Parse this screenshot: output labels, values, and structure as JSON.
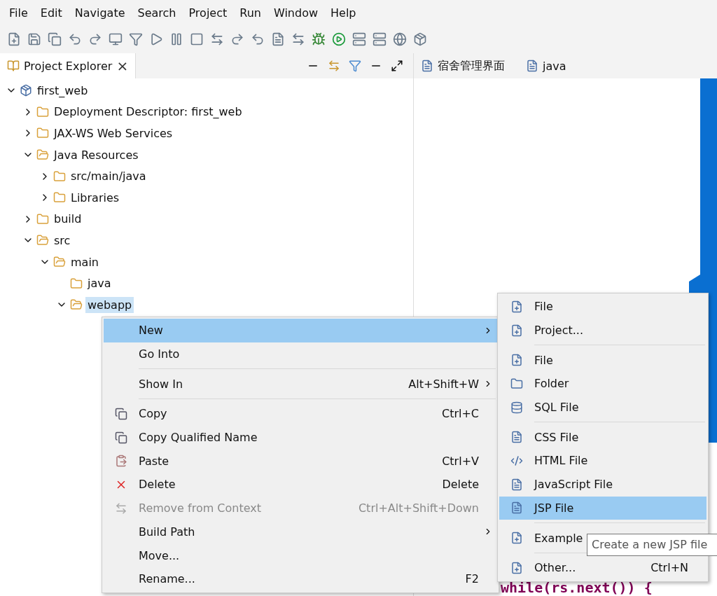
{
  "menu_bar": [
    "File",
    "Edit",
    "Navigate",
    "Search",
    "Project",
    "Run",
    "Window",
    "Help"
  ],
  "project_explorer": {
    "title": "Project Explorer",
    "close": "×",
    "tree": [
      {
        "label": "first_web",
        "expanded": true,
        "selected": false,
        "children": [
          {
            "label": "Deployment Descriptor: first_web",
            "expanded": false,
            "selected": false
          },
          {
            "label": "JAX-WS Web Services",
            "expanded": false,
            "selected": false
          },
          {
            "label": "Java Resources",
            "expanded": true,
            "selected": false,
            "children": [
              {
                "label": "src/main/java",
                "expanded": false,
                "selected": false
              },
              {
                "label": "Libraries",
                "expanded": false,
                "selected": false
              }
            ]
          },
          {
            "label": "build",
            "expanded": false,
            "selected": false
          },
          {
            "label": "src",
            "expanded": true,
            "selected": false,
            "children": [
              {
                "label": "main",
                "expanded": true,
                "selected": false,
                "children": [
                  {
                    "label": "java",
                    "selected": false
                  },
                  {
                    "label": "webapp",
                    "expanded": true,
                    "selected": true
                  }
                ]
              }
            ]
          }
        ]
      }
    ]
  },
  "editor_tabs": [
    {
      "label": "宿舍管理界面"
    },
    {
      "label": "java"
    }
  ],
  "code_line": "while(rs.next()) {",
  "context_menu": [
    {
      "kind": "item",
      "label": "New",
      "submenu": true,
      "selected": true,
      "disabled": false
    },
    {
      "kind": "item",
      "label": "Go Into",
      "selected": false,
      "disabled": false
    },
    {
      "kind": "separator"
    },
    {
      "kind": "item",
      "label": "Show In",
      "shortcut": "Alt+Shift+W",
      "submenu": true,
      "selected": false,
      "disabled": false
    },
    {
      "kind": "separator"
    },
    {
      "kind": "item",
      "label": "Copy",
      "shortcut": "Ctrl+C",
      "selected": false,
      "disabled": false
    },
    {
      "kind": "item",
      "label": "Copy Qualified Name",
      "selected": false,
      "disabled": false
    },
    {
      "kind": "item",
      "label": "Paste",
      "shortcut": "Ctrl+V",
      "selected": false,
      "disabled": false
    },
    {
      "kind": "item",
      "label": "Delete",
      "shortcut": "Delete",
      "selected": false,
      "disabled": false
    },
    {
      "kind": "item",
      "label": "Remove from Context",
      "shortcut": "Ctrl+Alt+Shift+Down",
      "selected": false,
      "disabled": true
    },
    {
      "kind": "item",
      "label": "Build Path",
      "submenu": true,
      "selected": false,
      "disabled": false
    },
    {
      "kind": "item",
      "label": "Move...",
      "selected": false,
      "disabled": false
    },
    {
      "kind": "item",
      "label": "Rename...",
      "shortcut": "F2",
      "selected": false,
      "disabled": false
    }
  ],
  "new_submenu": [
    {
      "kind": "item",
      "label": "File",
      "selected": false
    },
    {
      "kind": "item",
      "label": "Project...",
      "selected": false
    },
    {
      "kind": "separator"
    },
    {
      "kind": "item",
      "label": "File",
      "selected": false
    },
    {
      "kind": "item",
      "label": "Folder",
      "selected": false
    },
    {
      "kind": "item",
      "label": "SQL File",
      "selected": false
    },
    {
      "kind": "separator"
    },
    {
      "kind": "item",
      "label": "CSS File",
      "selected": false
    },
    {
      "kind": "item",
      "label": "HTML File",
      "selected": false
    },
    {
      "kind": "item",
      "label": "JavaScript File",
      "selected": false
    },
    {
      "kind": "item",
      "label": "JSP File",
      "selected": true
    },
    {
      "kind": "separator"
    },
    {
      "kind": "item",
      "label": "Example",
      "selected": false
    },
    {
      "kind": "separator"
    },
    {
      "kind": "item",
      "label": "Other...",
      "shortcut": "Ctrl+N",
      "selected": false
    }
  ],
  "tooltip": "Create a new JSP file"
}
